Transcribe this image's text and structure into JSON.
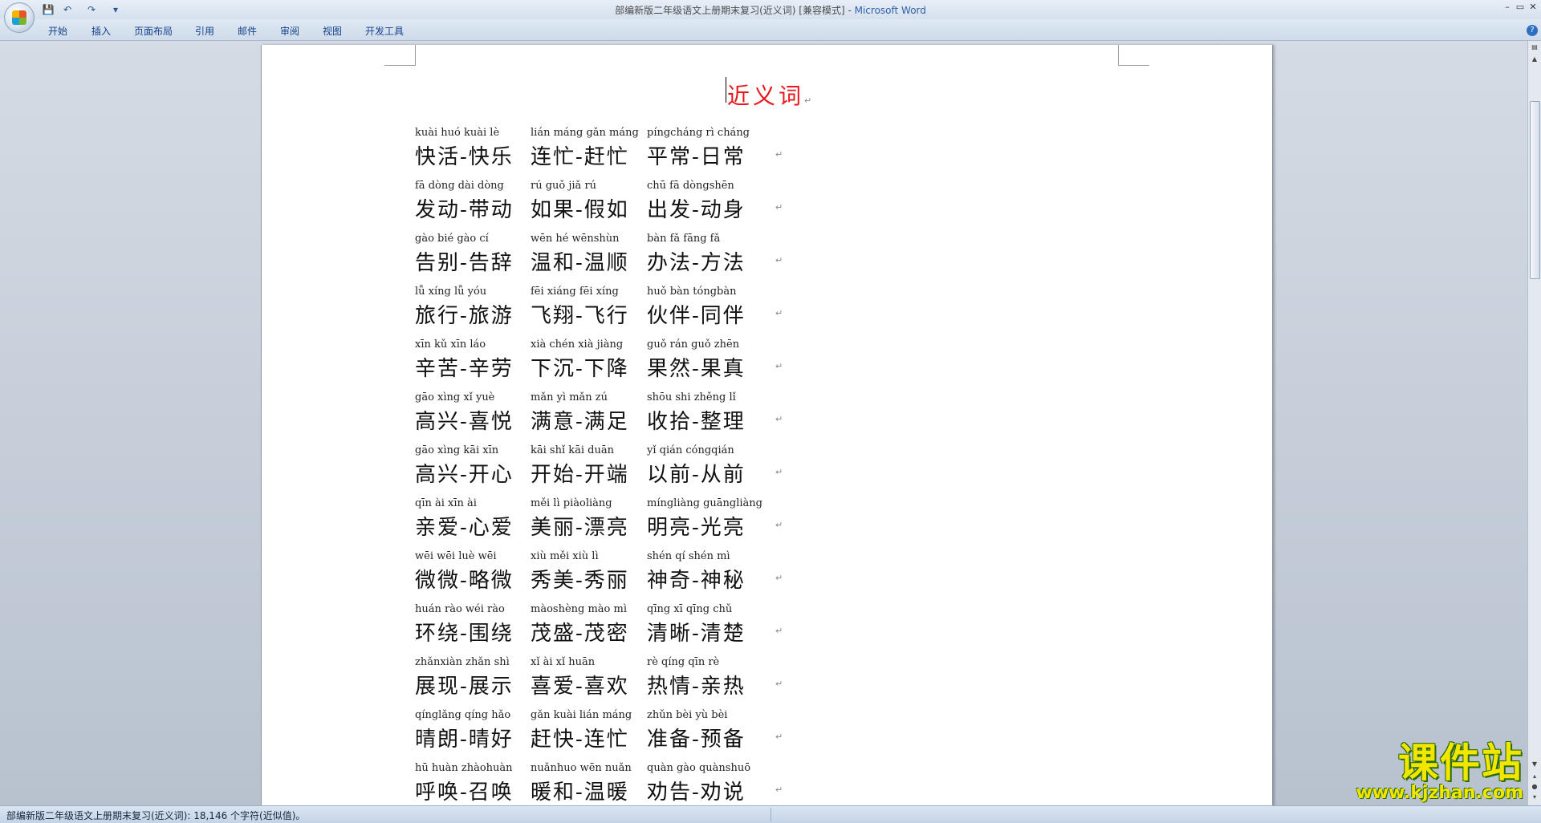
{
  "window": {
    "title": "部编新版二年级语文上册期末复习(近义词) [兼容模式]",
    "app_name": "Microsoft Word",
    "minimize": "–",
    "maximize": "▭",
    "close": "✕"
  },
  "qat": {
    "save": "💾",
    "undo": "↶",
    "redo": "↷",
    "more": "▾"
  },
  "ribbon_tabs": [
    "开始",
    "插入",
    "页面布局",
    "引用",
    "邮件",
    "审阅",
    "视图",
    "开发工具"
  ],
  "help": "?",
  "document": {
    "title": "近义词",
    "para_mark": "↵",
    "rows": [
      [
        {
          "pinyin": "kuài huó  kuài  lè",
          "hanzi": "快活-快乐"
        },
        {
          "pinyin": "lián máng  gǎn máng",
          "hanzi": "连忙-赶忙"
        },
        {
          "pinyin": "píngcháng  rì  cháng",
          "hanzi": "平常-日常"
        }
      ],
      [
        {
          "pinyin": "fā dòng  dài dòng",
          "hanzi": "发动-带动"
        },
        {
          "pinyin": "rú guǒ  jiǎ  rú",
          "hanzi": "如果-假如"
        },
        {
          "pinyin": "chū  fā  dòngshēn",
          "hanzi": "出发-动身"
        }
      ],
      [
        {
          "pinyin": "gào bié  gào  cí",
          "hanzi": "告别-告辞"
        },
        {
          "pinyin": "wēn hé  wēnshùn",
          "hanzi": "温和-温顺"
        },
        {
          "pinyin": "bàn  fǎ  fāng  fǎ",
          "hanzi": "办法-方法"
        }
      ],
      [
        {
          "pinyin": "lǚ xíng  lǚ  yóu",
          "hanzi": "旅行-旅游"
        },
        {
          "pinyin": "fēi xiáng  fēi xíng",
          "hanzi": "飞翔-飞行"
        },
        {
          "pinyin": "huǒ bàn  tóngbàn",
          "hanzi": "伙伴-同伴"
        }
      ],
      [
        {
          "pinyin": "xīn  kǔ  xīn  láo",
          "hanzi": "辛苦-辛劳"
        },
        {
          "pinyin": "xià chén  xià jiàng",
          "hanzi": "下沉-下降"
        },
        {
          "pinyin": "guǒ  rán  guǒ zhēn",
          "hanzi": "果然-果真"
        }
      ],
      [
        {
          "pinyin": "gāo xìng  xǐ  yuè",
          "hanzi": "高兴-喜悦"
        },
        {
          "pinyin": "mǎn  yì  mǎn  zú",
          "hanzi": "满意-满足"
        },
        {
          "pinyin": "shōu shi  zhěng  lǐ",
          "hanzi": "收拾-整理"
        }
      ],
      [
        {
          "pinyin": "gāo xìng  kāi  xīn",
          "hanzi": "高兴-开心"
        },
        {
          "pinyin": "kāi  shǐ  kāi duān",
          "hanzi": "开始-开端"
        },
        {
          "pinyin": "yǐ  qián  cóngqián",
          "hanzi": "以前-从前"
        }
      ],
      [
        {
          "pinyin": "qīn  ài  xīn  ài",
          "hanzi": "亲爱-心爱"
        },
        {
          "pinyin": "měi  lì  piàoliàng",
          "hanzi": "美丽-漂亮"
        },
        {
          "pinyin": "míngliàng guāngliàng",
          "hanzi": "明亮-光亮"
        }
      ],
      [
        {
          "pinyin": "wēi  wēi  luè  wēi",
          "hanzi": "微微-略微"
        },
        {
          "pinyin": "xiù měi  xiù  lì",
          "hanzi": "秀美-秀丽"
        },
        {
          "pinyin": "shén  qí  shén  mì",
          "hanzi": "神奇-神秘"
        }
      ],
      [
        {
          "pinyin": "huán rào  wéi  rào",
          "hanzi": "环绕-围绕"
        },
        {
          "pinyin": "màoshèng mào  mì",
          "hanzi": "茂盛-茂密"
        },
        {
          "pinyin": "qīng  xī  qīng chǔ",
          "hanzi": "清晰-清楚"
        }
      ],
      [
        {
          "pinyin": "zhǎnxiàn  zhǎn shì",
          "hanzi": "展现-展示"
        },
        {
          "pinyin": "xǐ  ài  xǐ  huān",
          "hanzi": "喜爱-喜欢"
        },
        {
          "pinyin": "rè  qíng  qīn  rè",
          "hanzi": "热情-亲热"
        }
      ],
      [
        {
          "pinyin": "qínglǎng  qíng hǎo",
          "hanzi": "晴朗-晴好"
        },
        {
          "pinyin": "gǎn kuài  lián máng",
          "hanzi": "赶快-连忙"
        },
        {
          "pinyin": "zhǔn bèi  yù  bèi",
          "hanzi": "准备-预备"
        }
      ],
      [
        {
          "pinyin": "hū  huàn  zhàohuàn",
          "hanzi": "呼唤-召唤"
        },
        {
          "pinyin": "nuǎnhuo  wēn nuǎn",
          "hanzi": "暖和-温暖"
        },
        {
          "pinyin": "quàn gào  quànshuō",
          "hanzi": "劝告-劝说"
        }
      ]
    ]
  },
  "status_bar": {
    "text": "部编新版二年级语文上册期末复习(近义词): 18,146 个字符(近似值)。"
  },
  "watermark": {
    "main": "课件站",
    "url": "www.kjzhan.com"
  },
  "colors": {
    "title_red": "#e8171b",
    "word_blue": "#2d5fa8",
    "watermark_yellow": "#f2e600"
  }
}
